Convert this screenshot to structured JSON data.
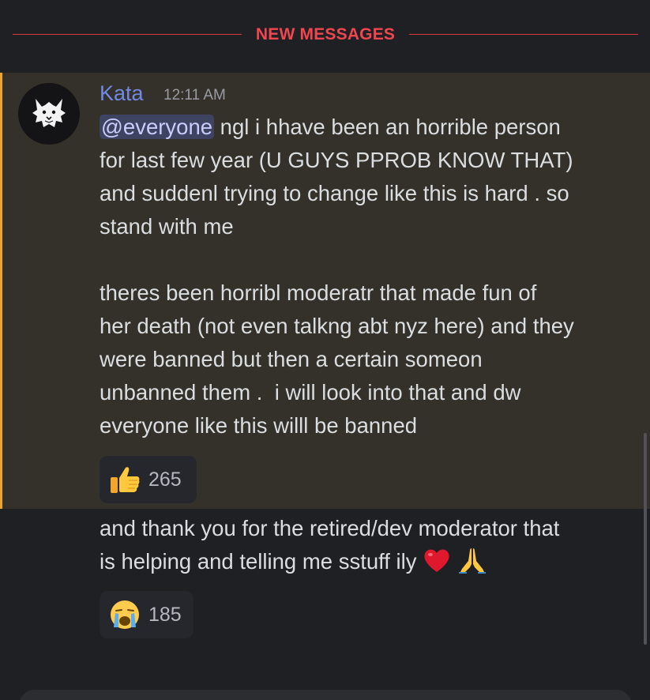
{
  "divider": {
    "label": "NEW MESSAGES"
  },
  "message": {
    "author": "Kata",
    "timestamp": "12:11 AM",
    "mention": "@everyone",
    "para1_lines": [
      " ngl i hhave been an horrible person",
      "for last few year (U GUYS PPROB KNOW THAT)",
      "and suddenl trying to change like this is hard . so",
      "stand with me"
    ],
    "para2_lines": [
      "theres been horribl moderatr that made fun of",
      "her death (not even talkng abt nyz here) and they",
      "were banned but then a certain someon",
      "unbanned them .  i will look into that and dw",
      "everyone like this willl be banned"
    ],
    "reaction": {
      "emoji": "thumbs-up-icon",
      "count": "265"
    }
  },
  "followup": {
    "lines": [
      "and thank you for the retired/dev moderator that",
      "is helping and telling me sstuff ily"
    ],
    "emojis": [
      "red-heart-icon",
      "folded-hands-icon"
    ],
    "reaction": {
      "emoji": "crying-face-icon",
      "count": "185"
    }
  },
  "colors": {
    "new_messages": "#ef4650",
    "username": "#7289e5",
    "highlight_bg": "#34312a",
    "highlight_bar": "#e8a630",
    "mention_bg": "#3f4362"
  }
}
